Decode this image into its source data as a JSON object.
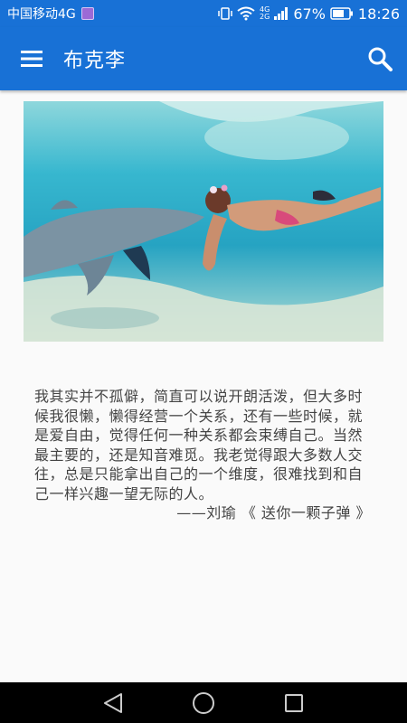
{
  "status_bar": {
    "carrier": "中国移动4G",
    "net_type_top": "4G",
    "net_type_bottom": "2G",
    "battery": "67%",
    "time": "18:26"
  },
  "app_bar": {
    "title": "布克李",
    "menu_icon": "hamburger-menu-icon",
    "search_icon": "search-icon"
  },
  "hero_image": {
    "description_icon": "photo"
  },
  "quote": {
    "text": "我其实并不孤僻，简直可以说开朗活泼，但大多时候我很懒，懒得经营一个关系，还有一些时候，就是爱自由，觉得任何一种关系都会束缚自己。当然最主要的，还是知音难觅。我老觉得跟大多数人交往，总是只能拿出自己的一个维度，很难找到和自己一样兴趣一望无际的人。",
    "attribution": "——刘瑜 《 送你一颗子弹 》"
  },
  "nav_bar": {
    "back_icon": "back-triangle-icon",
    "home_icon": "home-circle-icon",
    "recents_icon": "recents-square-icon"
  },
  "colors": {
    "primary": "#1871d6",
    "background": "#fafafa",
    "text": "#444444"
  }
}
